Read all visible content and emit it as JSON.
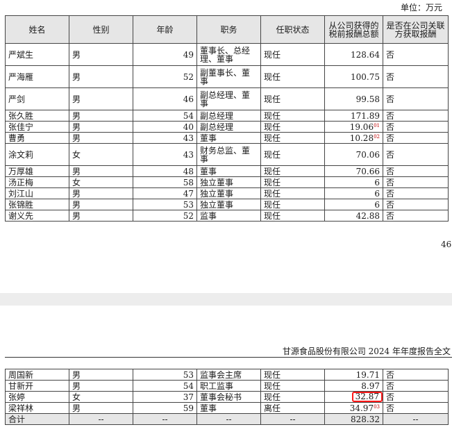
{
  "unit_label": "单位：万元",
  "headers": [
    "姓名",
    "性别",
    "年龄",
    "职务",
    "任职状态",
    "从公司获得的税前报酬总额",
    "是否在公司关联方获取报酬"
  ],
  "rows": [
    {
      "name": "严斌生",
      "gender": "男",
      "age": "49",
      "title": "董事长、总经理、董事",
      "status": "现任",
      "pay": "128.64",
      "note": "",
      "related": "否"
    },
    {
      "name": "严海雁",
      "gender": "男",
      "age": "52",
      "title": "副董事长、董事",
      "status": "现任",
      "pay": "100.75",
      "note": "",
      "related": "否"
    },
    {
      "name": "严剑",
      "gender": "男",
      "age": "46",
      "title": "副总经理、董事",
      "status": "现任",
      "pay": "99.58",
      "note": "",
      "related": "否"
    },
    {
      "name": "张久胜",
      "gender": "男",
      "age": "54",
      "title": "副总经理",
      "status": "现任",
      "pay": "171.89",
      "note": "",
      "related": "否"
    },
    {
      "name": "张佳宁",
      "gender": "男",
      "age": "40",
      "title": "副总经理",
      "status": "现任",
      "pay": "19.06",
      "note": "01",
      "related": "否"
    },
    {
      "name": "曹勇",
      "gender": "男",
      "age": "43",
      "title": "董事",
      "status": "现任",
      "pay": "10.28",
      "note": "02",
      "related": "否"
    },
    {
      "name": "涂文莉",
      "gender": "女",
      "age": "43",
      "title": "财务总监、董事",
      "status": "现任",
      "pay": "70.06",
      "note": "",
      "related": "否"
    },
    {
      "name": "万厚雄",
      "gender": "男",
      "age": "48",
      "title": "董事",
      "status": "现任",
      "pay": "70.66",
      "note": "",
      "related": "否"
    },
    {
      "name": "汤正梅",
      "gender": "女",
      "age": "58",
      "title": "独立董事",
      "status": "现任",
      "pay": "6",
      "note": "",
      "related": "否"
    },
    {
      "name": "刘江山",
      "gender": "男",
      "age": "47",
      "title": "独立董事",
      "status": "现任",
      "pay": "6",
      "note": "",
      "related": "否"
    },
    {
      "name": "张锦胜",
      "gender": "男",
      "age": "53",
      "title": "独立董事",
      "status": "现任",
      "pay": "6",
      "note": "",
      "related": "否"
    },
    {
      "name": "谢义先",
      "gender": "男",
      "age": "52",
      "title": "监事",
      "status": "现任",
      "pay": "42.88",
      "note": "",
      "related": "否"
    }
  ],
  "page_number": "46",
  "report_header": "甘源食品股份有限公司 2024 年年度报告全文",
  "rows2": [
    {
      "name": "周国新",
      "gender": "男",
      "age": "53",
      "title": "监事会主席",
      "status": "现任",
      "pay": "19.71",
      "note": "",
      "related": "否"
    },
    {
      "name": "甘新开",
      "gender": "男",
      "age": "54",
      "title": "职工监事",
      "status": "现任",
      "pay": "8.97",
      "note": "",
      "related": "否"
    },
    {
      "name": "张婷",
      "gender": "女",
      "age": "37",
      "title": "董事会秘书",
      "status": "现任",
      "pay": "32.87",
      "note": "",
      "related": "否"
    },
    {
      "name": "梁祥林",
      "gender": "男",
      "age": "59",
      "title": "董事",
      "status": "离任",
      "pay": "34.97",
      "note": "03",
      "related": "否"
    }
  ],
  "total": {
    "label": "合计",
    "gender": "--",
    "age": "--",
    "title": "--",
    "status": "--",
    "pay": "828.32",
    "related": "--"
  }
}
